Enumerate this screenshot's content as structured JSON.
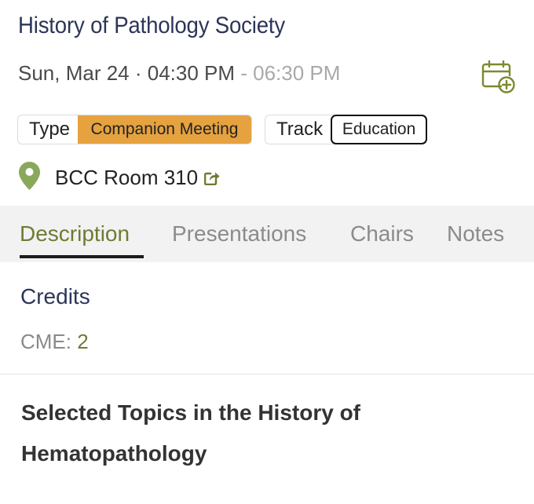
{
  "event": {
    "title": "History of Pathology Society",
    "date_start": "Sun, Mar 24 · 04:30 PM",
    "date_sep": " - ",
    "date_end": "06:30 PM"
  },
  "tags": {
    "type_label": "Type",
    "type_value": "Companion Meeting",
    "track_label": "Track",
    "track_value": "Education"
  },
  "location": {
    "room": "BCC Room 310"
  },
  "tabs": [
    {
      "label": "Description",
      "active": true
    },
    {
      "label": "Presentations",
      "active": false
    },
    {
      "label": "Chairs",
      "active": false
    },
    {
      "label": "Notes",
      "active": false
    }
  ],
  "credits": {
    "heading": "Credits",
    "cme_label": "CME: ",
    "cme_value": "2"
  },
  "session": {
    "title": "Selected Topics in the History of Hematopathology"
  },
  "icons": {
    "calendar": "calendar-add-icon",
    "location": "map-pin-icon",
    "share": "share-icon"
  },
  "colors": {
    "title": "#2c3558",
    "accent_olive": "#6d7c32",
    "type_chip": "#e5a23f",
    "pin": "#8aa85c"
  }
}
